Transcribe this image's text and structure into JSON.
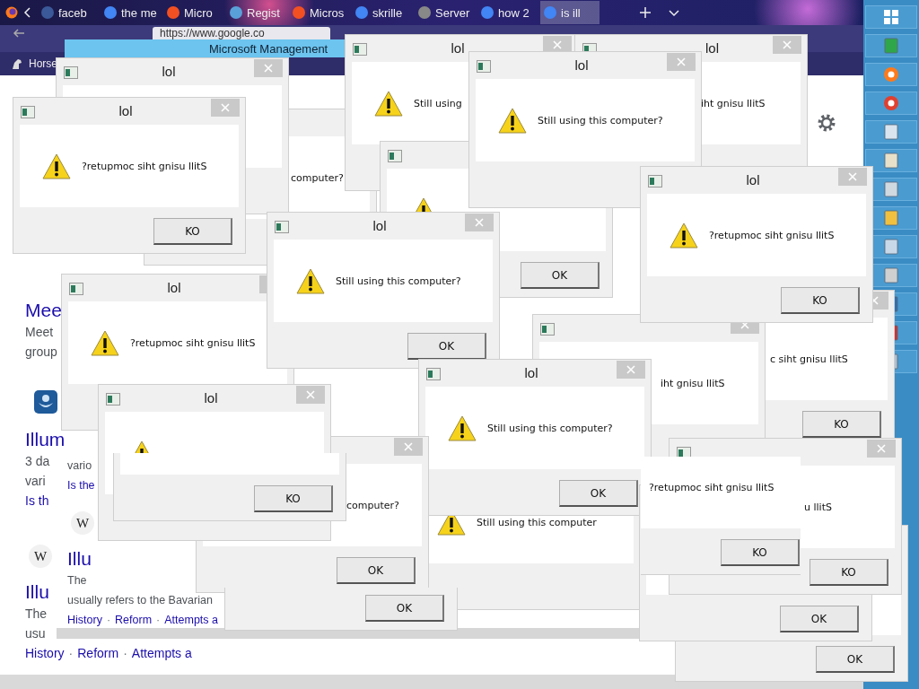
{
  "browser": {
    "tabs": [
      {
        "label": "faceb",
        "selected": false
      },
      {
        "label": "the me",
        "selected": false
      },
      {
        "label": "Micro",
        "selected": false
      },
      {
        "label": "Regist",
        "selected": false
      },
      {
        "label": "Micros",
        "selected": false
      },
      {
        "label": "skrille",
        "selected": false
      },
      {
        "label": "Server",
        "selected": false
      },
      {
        "label": "how 2",
        "selected": false
      },
      {
        "label": "is ill",
        "selected": true
      }
    ],
    "address": "https://www.google.co",
    "bookmark": "Horse"
  },
  "mmc_window": {
    "title": "Microsoft Management"
  },
  "page": {
    "items": [
      {
        "kind": "heading",
        "text": "Mee"
      },
      {
        "kind": "text",
        "text": "Meet"
      },
      {
        "kind": "text",
        "text": "group"
      },
      {
        "kind": "icon"
      },
      {
        "kind": "heading",
        "text": "Illum"
      },
      {
        "kind": "text",
        "text": "3 da"
      },
      {
        "kind": "text",
        "text": "vari"
      },
      {
        "kind": "link",
        "text": "Is th"
      },
      {
        "kind": "badge",
        "text": "W"
      },
      {
        "kind": "heading",
        "text": "Illu"
      },
      {
        "kind": "text",
        "text": "The"
      },
      {
        "kind": "text",
        "text": "usu"
      },
      {
        "kind": "links",
        "separator": "·",
        "links": [
          "History",
          "Reform",
          "Attempts a"
        ]
      }
    ]
  },
  "overlay_page": {
    "items": [
      {
        "kind": "text",
        "text": "vario"
      },
      {
        "kind": "link",
        "text": "Is the"
      },
      {
        "kind": "badge",
        "text": "W"
      },
      {
        "kind": "heading",
        "text": "Illu"
      },
      {
        "kind": "text",
        "text": "The"
      },
      {
        "kind": "text",
        "text": "usually refers to the Bavarian"
      },
      {
        "kind": "links",
        "separator": "·",
        "links": [
          "History",
          "Reform",
          "Attempts a"
        ]
      }
    ]
  },
  "dialogs": [
    {
      "message": "computer?"
    },
    {
      "title": "lol"
    },
    {
      "title": "lol",
      "message": "Still using"
    },
    {
      "title": "lol",
      "message": "iht gnisu llitS"
    },
    {
      "title": "lol",
      "message": "Still using this computer?"
    },
    {
      "button": "OK"
    },
    {
      "message": "c siht gnisu llitS",
      "button": "KO"
    },
    {
      "message": "iht gnisu llitS"
    },
    {
      "title": "lol",
      "message": "?retupmoc siht gnisu llitS",
      "button": "KO"
    },
    {
      "title": "lol",
      "message": "?retupmoc siht gnisu llitS",
      "button": "KO"
    },
    {
      "title": "lol",
      "message": "?retupmoc siht gnisu llitS"
    },
    {
      "title": "lol",
      "message": "Still using this computer?",
      "button": "OK"
    },
    {
      "title": "lol",
      "message": "Still using this computer?",
      "button": "OK"
    },
    {
      "message": "Still using this computer"
    },
    {
      "message": "computer?",
      "button": "OK"
    },
    {
      "title": "lol"
    },
    {
      "button": "KO"
    },
    {
      "button": "OK"
    },
    {
      "message": "?retupmoc siht gnisu llitS",
      "button": "KO"
    },
    {
      "message": "u llitS",
      "button": "KO"
    },
    {
      "button": "OK"
    },
    {
      "button": "OK"
    }
  ]
}
